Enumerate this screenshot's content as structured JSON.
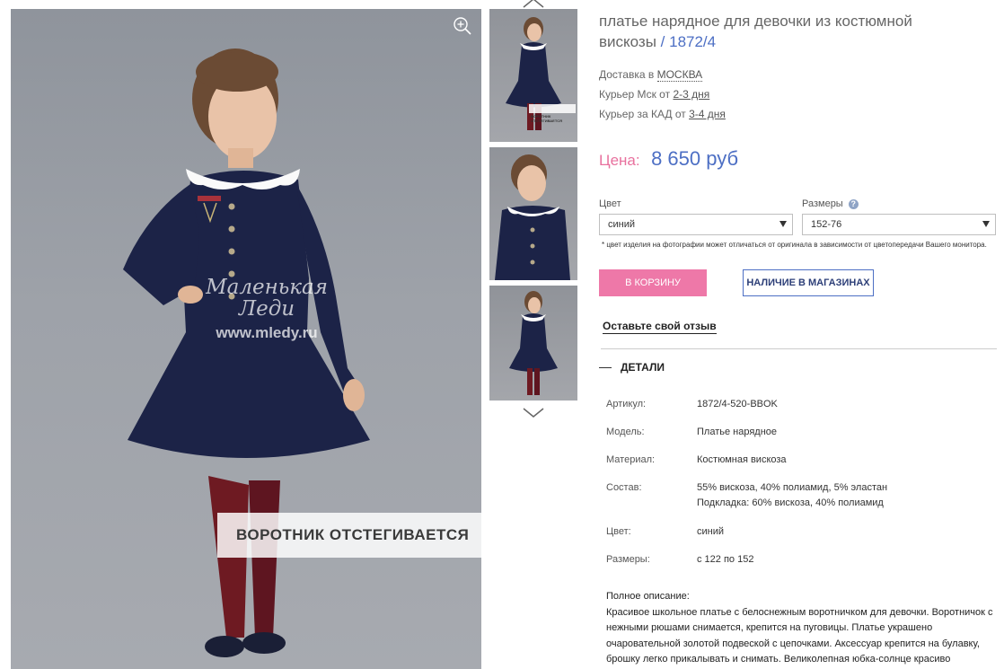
{
  "product": {
    "title": "платье нарядное для девочки из костюмной вискозы",
    "article_suffix": "/ 1872/4"
  },
  "delivery": {
    "prefix": "Доставка в",
    "city": "МОСКВА",
    "courier_msk_prefix": "Курьер Мск от",
    "courier_msk_days": "2-3 дня",
    "courier_kad_prefix": "Курьер за КАД от",
    "courier_kad_days": "3-4 дня"
  },
  "price": {
    "label": "Цена:",
    "value": "8 650 руб"
  },
  "color_field": {
    "label": "Цвет",
    "selected": "синий"
  },
  "size_field": {
    "label": "Размеры",
    "help": "?",
    "selected": "152-76"
  },
  "note": "* цвет изделия на фотографии может отличаться от оригинала в зависимости от цветопередачи Вашего монитора.",
  "buttons": {
    "cart": "В КОРЗИНУ",
    "stock": "НАЛИЧИЕ В МАГАЗИНАХ",
    "review": "Оставьте свой отзыв"
  },
  "details": {
    "heading": "ДЕТАЛИ",
    "specs": [
      {
        "key": "Артикул:",
        "value": "1872/4-520-BBOK"
      },
      {
        "key": "Модель:",
        "value": "Платье нарядное"
      },
      {
        "key": "Материал:",
        "value": "Костюмная вискоза"
      },
      {
        "key": "Состав:",
        "value": "55% вискоза, 40% полиамид, 5% эластан",
        "value2": "Подкладка: 60% вискоза, 40% полиамид"
      },
      {
        "key": "Цвет:",
        "value": "синий"
      },
      {
        "key": "Размеры:",
        "value": "с 122 по 152"
      }
    ],
    "description_label": "Полное описание:",
    "description": "Красивое школьное платье с белоснежным воротничком для девочки. Воротничок с нежными рюшами снимается, крепится на пуговицы. Платье украшено очаровательной золотой подвеской с цепочками. Аксессуар крепится на булавку, брошку легко прикалывать и снимать. Великолепная юбка-солнце красиво развевается при ходьбе. В боковых швах"
  },
  "photo": {
    "watermark_brand": "Маленькая Леди",
    "watermark_url": "www.mledy.ru",
    "caption": "ВОРОТНИК ОТСТЕГИВАЕТСЯ",
    "thumb_caption": "ВОРОТНИК ОТСТЕГИВАЕТСЯ"
  },
  "colors": {
    "accent_blue": "#4d6fc4",
    "accent_pink": "#ee78a8",
    "dress_navy": "#1c2347",
    "tights_burgundy": "#6e1a22"
  },
  "icons": [
    "zoom-in-icon",
    "chevron-up-icon",
    "chevron-down-icon",
    "dropdown-arrow-icon",
    "help-icon"
  ]
}
